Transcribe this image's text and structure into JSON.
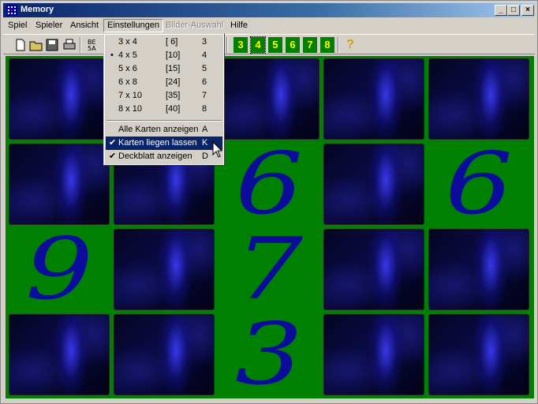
{
  "window": {
    "title": "Memory",
    "minimize": "_",
    "maximize": "□",
    "close": "×"
  },
  "menubar": [
    {
      "label": "Spiel"
    },
    {
      "label": "Spieler"
    },
    {
      "label": "Ansicht"
    },
    {
      "label": "Einstellungen"
    },
    {
      "label": "Bilder-Auswahl"
    },
    {
      "label": "Hilfe"
    }
  ],
  "toolbar": {
    "icons": [
      "new-icon",
      "open-icon",
      "save-icon",
      "print-icon",
      "sort-icon",
      "card3-icon",
      "card4-icon",
      "card5-icon",
      "card6-icon",
      "card7-icon",
      "card8-icon",
      "help-icon"
    ],
    "digits": [
      "3",
      "4",
      "5",
      "6",
      "7",
      "8"
    ],
    "help": "?"
  },
  "menu": {
    "sizes": [
      {
        "size": "3 x 4",
        "pairs": "[ 6]",
        "key": "3",
        "selected": false
      },
      {
        "size": "4 x 5",
        "pairs": "[10]",
        "key": "4",
        "selected": true
      },
      {
        "size": "5 x 6",
        "pairs": "[15]",
        "key": "5",
        "selected": false
      },
      {
        "size": "6 x 8",
        "pairs": "[24]",
        "key": "6",
        "selected": false
      },
      {
        "size": "7 x 10",
        "pairs": "[35]",
        "key": "7",
        "selected": false
      },
      {
        "size": "8 x 10",
        "pairs": "[40]",
        "key": "8",
        "selected": false
      }
    ],
    "options": [
      {
        "label": "Alle Karten anzeigen",
        "key": "A",
        "checked": false,
        "highlighted": false
      },
      {
        "label": "Karten liegen lassen",
        "key": "K",
        "checked": true,
        "highlighted": true
      },
      {
        "label": "Deckblatt anzeigen",
        "key": "D",
        "checked": true,
        "highlighted": false
      }
    ],
    "bullet": "•",
    "check": "✔"
  },
  "board": {
    "rows": [
      [
        "back",
        "back",
        "back",
        "back",
        "back"
      ],
      [
        "back",
        "back",
        "6",
        "back",
        "6"
      ],
      [
        "9",
        "back",
        "7",
        "back",
        "back"
      ],
      [
        "back",
        "back",
        "3",
        "back",
        "back"
      ]
    ]
  }
}
